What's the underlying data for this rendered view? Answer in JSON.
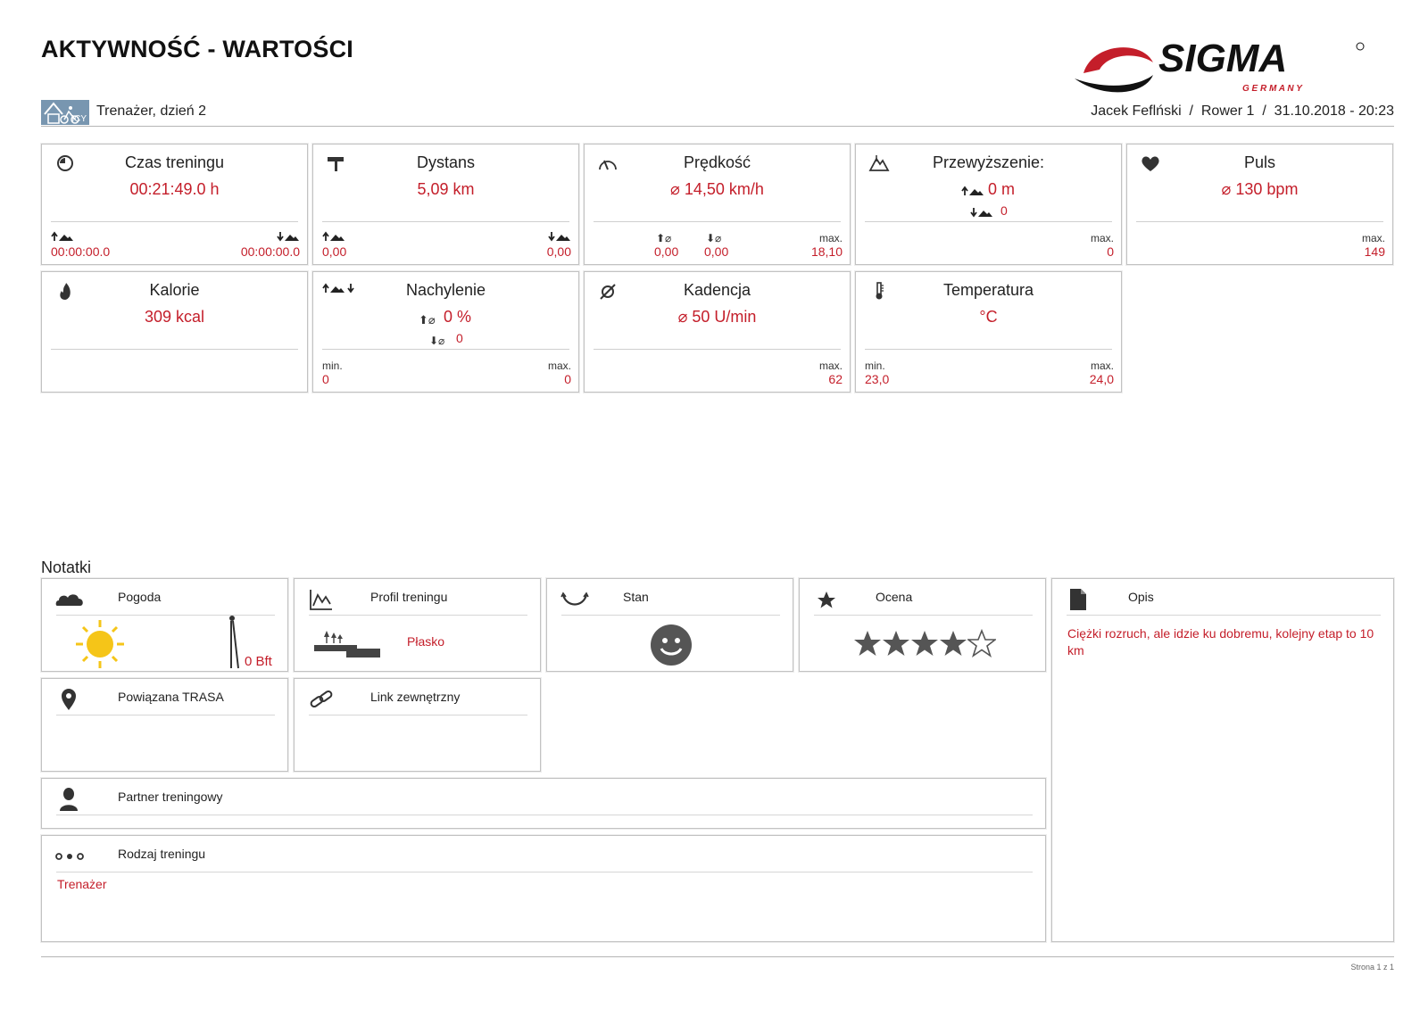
{
  "page": {
    "title": "AKTYWNOŚĆ - WARTOŚCI"
  },
  "logo": {
    "brand": "SIGMA",
    "tagline": "G E R M A N Y"
  },
  "header": {
    "sport_label": "ICY",
    "activity_name": "Trenażer, dzień 2",
    "meta": "Jacek Feflński  /  Rower 1  /  31.10.2018 - 20:23"
  },
  "tiles": {
    "training_time": {
      "title": "Czas treningu",
      "value": "00:21:49.0 h",
      "left_value": "00:00:00.0",
      "right_value": "00:00:00.0"
    },
    "distance": {
      "title": "Dystans",
      "value": "5,09 km",
      "left_value": "0,00",
      "right_value": "0,00"
    },
    "speed": {
      "title": "Prędkość",
      "value": "⌀ 14,50 km/h",
      "up_value": "0,00",
      "down_value": "0,00",
      "max_label": "max.",
      "max_value": "18,10"
    },
    "elevation": {
      "title": "Przewyższenie:",
      "value": "0 m",
      "sub_value": "0",
      "max_label": "max.",
      "max_value": "0"
    },
    "pulse": {
      "title": "Puls",
      "value": "⌀ 130 bpm",
      "max_label": "max.",
      "max_value": "149"
    },
    "calories": {
      "title": "Kalorie",
      "value": "309 kcal"
    },
    "incline": {
      "title": "Nachylenie",
      "value": "0 %",
      "sub_value": "0",
      "min_label": "min.",
      "min_value": "0",
      "max_label": "max.",
      "max_value": "0"
    },
    "cadence": {
      "title": "Kadencja",
      "value": "⌀ 50 U/min",
      "max_label": "max.",
      "max_value": "62"
    },
    "temperature": {
      "title": "Temperatura",
      "value": "°C",
      "min_label": "min.",
      "min_value": "23,0",
      "max_label": "max.",
      "max_value": "24,0"
    }
  },
  "notes": {
    "title": "Notatki",
    "weather": {
      "title": "Pogoda",
      "wind": "0 Bft"
    },
    "profile": {
      "title": "Profil treningu",
      "value": "Płasko"
    },
    "condition": {
      "title": "Stan"
    },
    "rating": {
      "title": "Ocena",
      "stars": 4,
      "max_stars": 5
    },
    "description": {
      "title": "Opis",
      "text": "Ciężki rozruch, ale idzie ku dobremu, kolejny etap to 10 km"
    },
    "route": {
      "title": "Powiązana TRASA"
    },
    "link": {
      "title": "Link zewnętrzny"
    },
    "partner": {
      "title": "Partner treningowy"
    },
    "training_type": {
      "title": "Rodzaj treningu",
      "value": "Trenażer"
    }
  },
  "footer": {
    "page": "Strona 1 z 1"
  },
  "colors": {
    "accent_red": "#c41e2a",
    "border": "#c2c2c2",
    "icon_dark": "#333333",
    "sun": "#f5c518",
    "sport_bg": "#7896b0"
  }
}
